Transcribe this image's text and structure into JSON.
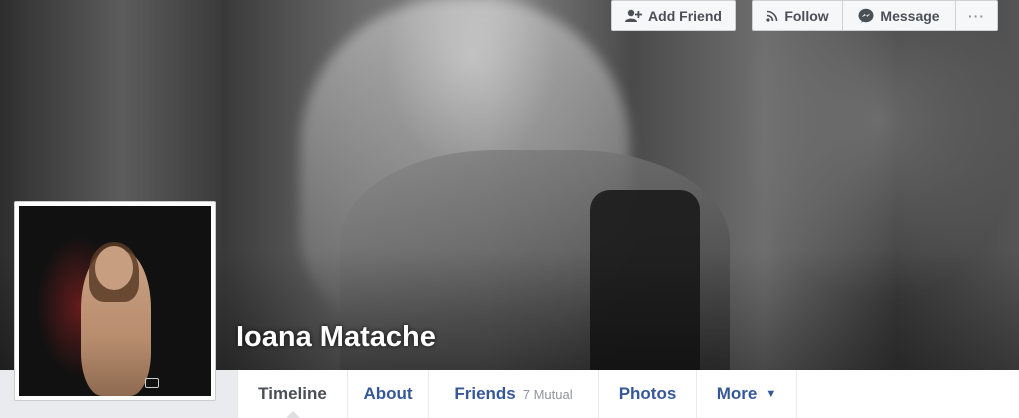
{
  "profile": {
    "name": "Ioana Matache"
  },
  "actions": {
    "add_friend": "Add Friend",
    "follow": "Follow",
    "message": "Message",
    "more": "···"
  },
  "tabs": [
    {
      "label": "Timeline"
    },
    {
      "label": "About"
    },
    {
      "label": "Friends",
      "sub": "7 Mutual"
    },
    {
      "label": "Photos"
    },
    {
      "label": "More"
    }
  ],
  "icons": {
    "add_friend": "add-friend-icon",
    "follow": "rss-icon",
    "message": "messenger-icon",
    "more_tab": "caret-down-icon"
  },
  "colors": {
    "link": "#365899",
    "button_bg": "#f6f7f9",
    "page_bg": "#e9ebee"
  }
}
